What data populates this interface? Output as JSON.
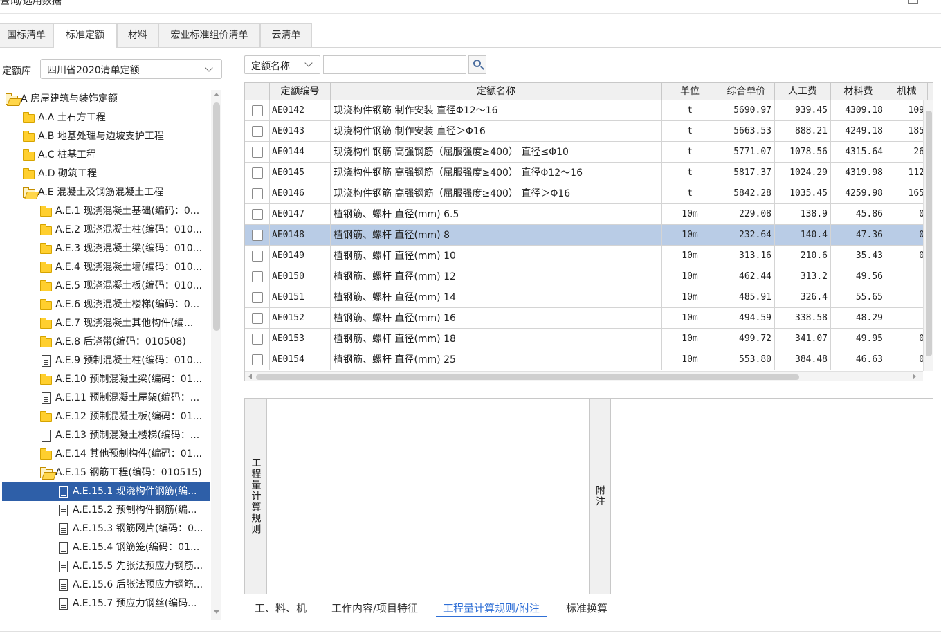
{
  "window": {
    "title": "查询/选用数据"
  },
  "tabs": [
    {
      "label": "国标清单"
    },
    {
      "label": "标准定额",
      "active": true
    },
    {
      "label": "材料"
    },
    {
      "label": "宏业标准组价清单"
    },
    {
      "label": "云清单"
    }
  ],
  "library": {
    "label": "定额库",
    "selected": "四川省2020清单定额"
  },
  "tree": [
    {
      "label": "A 房屋建筑与装饰定额",
      "icon": "folder-open"
    },
    {
      "label": "A.A 土石方工程",
      "icon": "folder"
    },
    {
      "label": "A.B 地基处理与边坡支护工程",
      "icon": "folder"
    },
    {
      "label": "A.C 桩基工程",
      "icon": "folder"
    },
    {
      "label": "A.D 砌筑工程",
      "icon": "folder"
    },
    {
      "label": "A.E 混凝土及钢筋混凝土工程",
      "icon": "folder-open"
    },
    {
      "label": "A.E.1 现浇混凝土基础(编码：0...",
      "icon": "folder"
    },
    {
      "label": "A.E.2 现浇混凝土柱(编码：010...",
      "icon": "folder"
    },
    {
      "label": "A.E.3 现浇混凝土梁(编码：010...",
      "icon": "folder"
    },
    {
      "label": "A.E.4 现浇混凝土墙(编码：010...",
      "icon": "folder"
    },
    {
      "label": "A.E.5 现浇混凝土板(编码：010...",
      "icon": "folder"
    },
    {
      "label": "A.E.6 现浇混凝土楼梯(编码：0...",
      "icon": "folder"
    },
    {
      "label": "A.E.7 现浇混凝土其他构件(编...",
      "icon": "folder"
    },
    {
      "label": "A.E.8 后浇带(编码：010508)",
      "icon": "folder"
    },
    {
      "label": "A.E.9 预制混凝土柱(编码：010...",
      "icon": "document"
    },
    {
      "label": "A.E.10 预制混凝土梁(编码：01...",
      "icon": "folder"
    },
    {
      "label": "A.E.11 预制混凝土屋架(编码：...",
      "icon": "document"
    },
    {
      "label": "A.E.12 预制混凝土板(编码：01...",
      "icon": "folder"
    },
    {
      "label": "A.E.13 预制混凝土楼梯(编码：...",
      "icon": "document"
    },
    {
      "label": "A.E.14 其他预制构件(编码：01...",
      "icon": "folder"
    },
    {
      "label": "A.E.15 钢筋工程(编码：010515)",
      "icon": "folder-open"
    },
    {
      "label": "A.E.15.1 现浇构件钢筋(编...",
      "icon": "document",
      "selected": true
    },
    {
      "label": "A.E.15.2 预制构件钢筋(编...",
      "icon": "document"
    },
    {
      "label": "A.E.15.3 钢筋网片(编码：0...",
      "icon": "document"
    },
    {
      "label": "A.E.15.4 钢筋笼(编码：01...",
      "icon": "document"
    },
    {
      "label": "A.E.15.5 先张法预应力钢筋...",
      "icon": "document"
    },
    {
      "label": "A.E.15.6 后张法预应力钢筋...",
      "icon": "document"
    },
    {
      "label": "A.E.15.7 预应力钢丝(编码...",
      "icon": "document"
    }
  ],
  "search": {
    "type": "定额名称",
    "value": ""
  },
  "table": {
    "columns": [
      "定额编号",
      "定额名称",
      "单位",
      "综合单价",
      "人工费",
      "材料费",
      "机械"
    ],
    "rows": [
      {
        "code": "AE0142",
        "name": "现浇构件钢筋 制作安装 直径Φ12～16",
        "unit": "t",
        "price": "5690.97",
        "labor": "939.45",
        "material": "4309.18",
        "machine": "109"
      },
      {
        "code": "AE0143",
        "name": "现浇构件钢筋 制作安装 直径＞Φ16",
        "unit": "t",
        "price": "5663.53",
        "labor": "888.21",
        "material": "4249.18",
        "machine": "185"
      },
      {
        "code": "AE0144",
        "name": "现浇构件钢筋 高强钢筋（屈服强度≥400） 直径≤Φ10",
        "unit": "t",
        "price": "5771.07",
        "labor": "1078.56",
        "material": "4315.64",
        "machine": "26"
      },
      {
        "code": "AE0145",
        "name": "现浇构件钢筋 高强钢筋（屈服强度≥400） 直径Φ12～16",
        "unit": "t",
        "price": "5817.37",
        "labor": "1024.29",
        "material": "4319.98",
        "machine": "112"
      },
      {
        "code": "AE0146",
        "name": "现浇构件钢筋 高强钢筋（屈服强度≥400） 直径＞Φ16",
        "unit": "t",
        "price": "5842.28",
        "labor": "1035.45",
        "material": "4259.98",
        "machine": "165"
      },
      {
        "code": "AE0147",
        "name": "植钢筋、螺杆 直径(mm) 6.5",
        "unit": "10m",
        "price": "229.08",
        "labor": "138.9",
        "material": "45.86",
        "machine": "0"
      },
      {
        "code": "AE0148",
        "name": "植钢筋、螺杆 直径(mm) 8",
        "unit": "10m",
        "price": "232.64",
        "labor": "140.4",
        "material": "47.36",
        "machine": "0",
        "selected": true
      },
      {
        "code": "AE0149",
        "name": "植钢筋、螺杆 直径(mm) 10",
        "unit": "10m",
        "price": "313.16",
        "labor": "210.6",
        "material": "35.43",
        "machine": "0"
      },
      {
        "code": "AE0150",
        "name": "植钢筋、螺杆 直径(mm) 12",
        "unit": "10m",
        "price": "462.44",
        "labor": "313.2",
        "material": "49.56",
        "machine": ""
      },
      {
        "code": "AE0151",
        "name": "植钢筋、螺杆 直径(mm) 14",
        "unit": "10m",
        "price": "485.91",
        "labor": "326.4",
        "material": "55.65",
        "machine": ""
      },
      {
        "code": "AE0152",
        "name": "植钢筋、螺杆 直径(mm) 16",
        "unit": "10m",
        "price": "494.59",
        "labor": "338.58",
        "material": "48.29",
        "machine": ""
      },
      {
        "code": "AE0153",
        "name": "植钢筋、螺杆 直径(mm) 18",
        "unit": "10m",
        "price": "499.72",
        "labor": "341.07",
        "material": "49.95",
        "machine": "0"
      },
      {
        "code": "AE0154",
        "name": "植钢筋、螺杆 直径(mm) 25",
        "unit": "10m",
        "price": "553.80",
        "labor": "384.48",
        "material": "46.63",
        "machine": "0"
      }
    ]
  },
  "detail": {
    "rules_label": "工程量计算规则",
    "notes_label": "附注"
  },
  "bottom_tabs": [
    {
      "label": "工、料、机"
    },
    {
      "label": "工作内容/项目特征"
    },
    {
      "label": "工程量计算规则/附注",
      "active": true
    },
    {
      "label": "标准换算"
    }
  ],
  "colors": {
    "selection": "#2e5fa8",
    "row_highlight": "#b9cce6",
    "accent": "#2f6fd6",
    "folder": "#ffcf2e"
  }
}
